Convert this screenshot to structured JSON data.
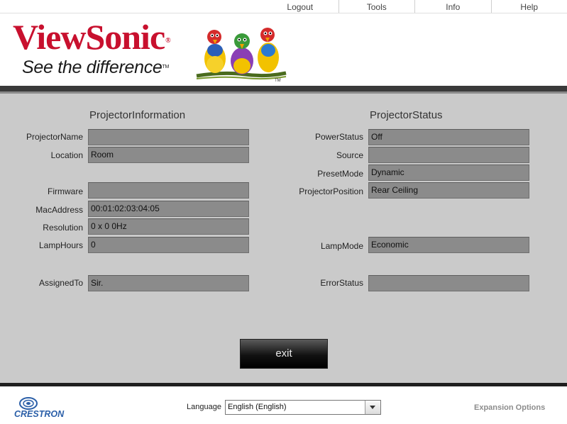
{
  "nav": {
    "items": [
      {
        "label": "Logout"
      },
      {
        "label": "Tools"
      },
      {
        "label": "Info"
      },
      {
        "label": "Help"
      }
    ]
  },
  "brand": {
    "name": "ViewSonic",
    "registered": "®",
    "tagline": "See the difference",
    "trademark": "TM",
    "birds_tm": "TM",
    "colors": {
      "brand_red": "#c8102e",
      "panel_gray": "#cacaca",
      "field_gray": "#8b8b8b"
    }
  },
  "projector_information": {
    "title": "ProjectorInformation",
    "rows": [
      {
        "label": "ProjectorName",
        "value": ""
      },
      {
        "label": "Location",
        "value": "Room"
      },
      {
        "label": "Firmware",
        "value": ""
      },
      {
        "label": "MacAddress",
        "value": "00:01:02:03:04:05"
      },
      {
        "label": "Resolution",
        "value": "0 x 0 0Hz"
      },
      {
        "label": "LampHours",
        "value": "0"
      },
      {
        "label": "AssignedTo",
        "value": "Sir."
      }
    ]
  },
  "projector_status": {
    "title": "ProjectorStatus",
    "rows": [
      {
        "label": "PowerStatus",
        "value": "Off"
      },
      {
        "label": "Source",
        "value": ""
      },
      {
        "label": "PresetMode",
        "value": "Dynamic"
      },
      {
        "label": "ProjectorPosition",
        "value": "Rear Ceiling"
      },
      {
        "label": "LampMode",
        "value": "Economic"
      },
      {
        "label": "ErrorStatus",
        "value": ""
      }
    ]
  },
  "exit_label": "exit",
  "footer": {
    "crestron": "CRESTRON",
    "language_label": "Language",
    "language_value": "English (English)",
    "expansion_label": "Expansion Options"
  }
}
